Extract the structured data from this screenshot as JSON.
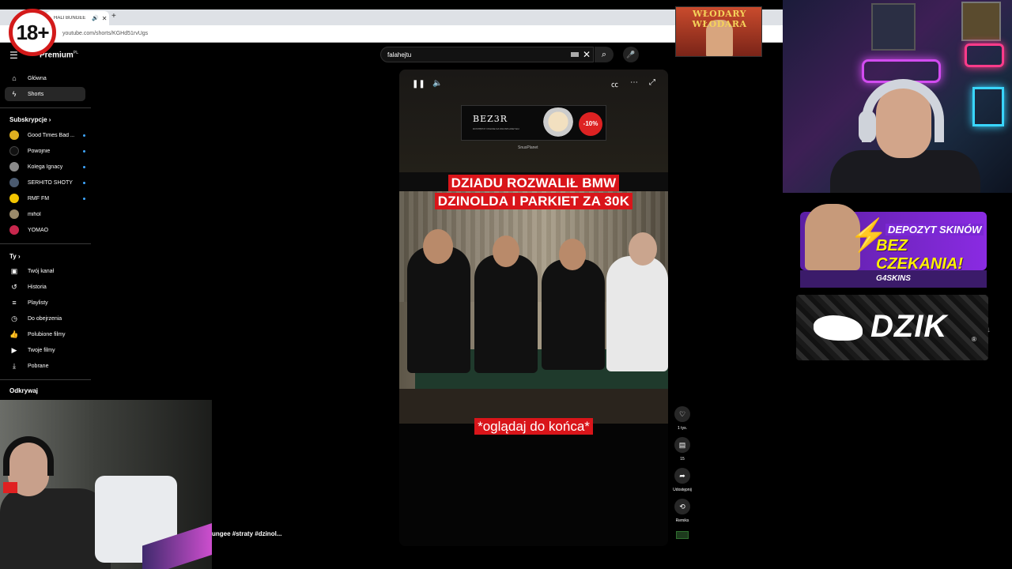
{
  "browser": {
    "tab_title": "HALI BUNGEE",
    "url": "youtube.com/shorts/KGHd51rvUgs",
    "new_tab": "+"
  },
  "overlay": {
    "age_badge": "18+",
    "top_banner": "WŁODARY WŁODARA",
    "promo_line1": "DEPOZYT SKINÓW",
    "promo_line2": "BEZ CZEKANIA!",
    "promo_brand": "G4SKINS",
    "sponsor": "DZIK",
    "sponsor_mark": "®"
  },
  "header": {
    "logo": "Premium",
    "logo_region": "PL",
    "search_value": "falahejtu"
  },
  "sidebar": {
    "main": [
      {
        "label": "Główna",
        "icon": "home-icon"
      },
      {
        "label": "Shorts",
        "icon": "shorts-icon"
      }
    ],
    "subs_heading": "Subskrypcje",
    "subscriptions": [
      {
        "label": "Good Times Bad ...",
        "color": "#e0b020"
      },
      {
        "label": "Powojnie",
        "color": "#111111"
      },
      {
        "label": "Kolega Ignacy",
        "color": "#8a8a8a"
      },
      {
        "label": "SERHITO SHOTY",
        "color": "#4a5a70"
      },
      {
        "label": "RMF FM",
        "color": "#f2c500"
      },
      {
        "label": "mihol",
        "color": "#9a8a6a"
      },
      {
        "label": "YOMAO",
        "color": "#c8274d"
      }
    ],
    "you_heading": "Ty",
    "you_items": [
      {
        "label": "Twój kanał",
        "icon": "channel-icon"
      },
      {
        "label": "Historia",
        "icon": "history-icon"
      },
      {
        "label": "Playlisty",
        "icon": "playlist-icon"
      },
      {
        "label": "Do obejrzenia",
        "icon": "clock-icon"
      },
      {
        "label": "Polubione filmy",
        "icon": "thumb-up-icon"
      },
      {
        "label": "Twoje filmy",
        "icon": "video-icon"
      },
      {
        "label": "Pobrane",
        "icon": "download-icon"
      }
    ],
    "explore_heading": "Odkrywaj"
  },
  "player": {
    "ad_brand": "BEZ3R",
    "ad_text": "DOSTĘPNY ONLINE NA SNUSPLANET.EU",
    "ad_discount": "-10%",
    "ad_partner": "SnusPlanet",
    "headline_line1": "DZIADU ROZWALIŁ BMW",
    "headline_line2": "DZINOLDA I PARKIET ZA 30K",
    "subtitle": "*oglądaj do końca*"
  },
  "actions": {
    "likes": "1 tys.",
    "comments": "15",
    "share": "Udostępnij",
    "remix": "Remiks"
  },
  "video_title_fragment": "ungee #straty #dzinol..."
}
